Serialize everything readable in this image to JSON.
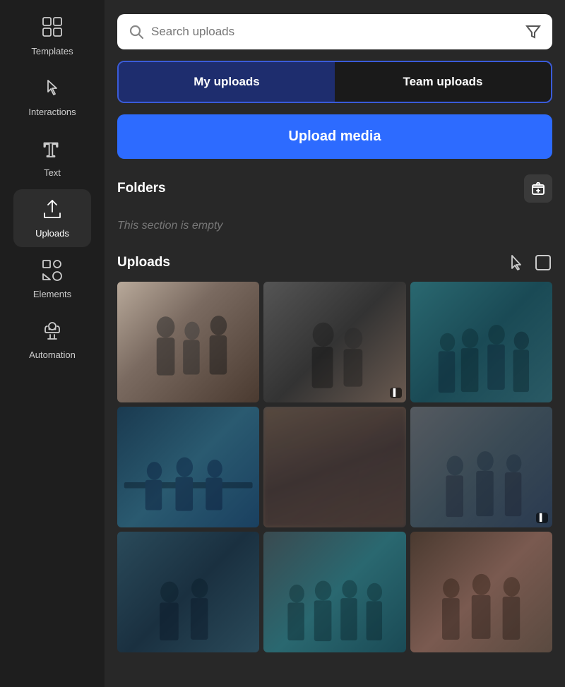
{
  "sidebar": {
    "items": [
      {
        "id": "templates",
        "label": "Templates",
        "icon": "templates"
      },
      {
        "id": "interactions",
        "label": "Interactions",
        "icon": "interactions"
      },
      {
        "id": "text",
        "label": "Text",
        "icon": "text"
      },
      {
        "id": "uploads",
        "label": "Uploads",
        "icon": "uploads",
        "active": true
      },
      {
        "id": "elements",
        "label": "Elements",
        "icon": "elements"
      },
      {
        "id": "automation",
        "label": "Automation",
        "icon": "automation"
      }
    ]
  },
  "search": {
    "placeholder": "Search uploads"
  },
  "tabs": [
    {
      "id": "my-uploads",
      "label": "My uploads",
      "active": true
    },
    {
      "id": "team-uploads",
      "label": "Team uploads",
      "active": false
    }
  ],
  "upload_button_label": "Upload media",
  "folders_section": {
    "title": "Folders",
    "empty_text": "This section is empty",
    "add_button_label": "+"
  },
  "uploads_section": {
    "title": "Uploads",
    "images": [
      {
        "id": 1,
        "css_class": "img-1",
        "alt": "Business people discussion"
      },
      {
        "id": 2,
        "css_class": "img-2",
        "alt": "Office workers",
        "badge": "▌"
      },
      {
        "id": 3,
        "css_class": "img-3",
        "alt": "Team meeting teal room"
      },
      {
        "id": 4,
        "css_class": "img-4",
        "alt": "People around table dark"
      },
      {
        "id": 5,
        "css_class": "img-5",
        "alt": "Blurred office scene"
      },
      {
        "id": 6,
        "css_class": "img-6",
        "alt": "People working",
        "badge": "▌"
      },
      {
        "id": 7,
        "css_class": "img-7",
        "alt": "Office group"
      },
      {
        "id": 8,
        "css_class": "img-8",
        "alt": "Meeting room teal"
      },
      {
        "id": 9,
        "css_class": "img-9",
        "alt": "Team discussion"
      }
    ]
  }
}
